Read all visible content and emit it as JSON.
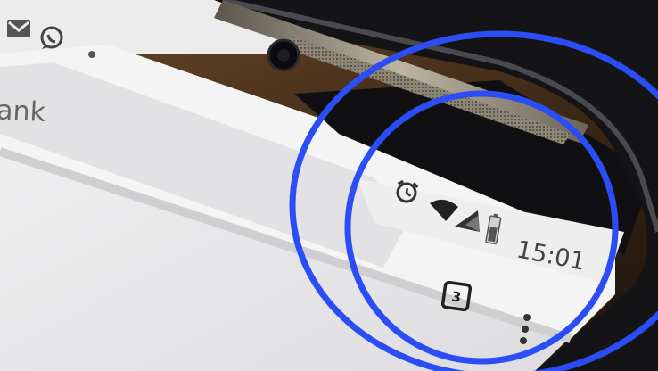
{
  "status_bar": {
    "time": "15:01",
    "notification_icons": [
      "gmail-icon",
      "whatsapp-icon",
      "notification-dot"
    ],
    "system_icons": [
      "alarm-icon",
      "wifi-icon",
      "signal-icon",
      "battery-icon"
    ]
  },
  "browser": {
    "address_text_fragment": "ank",
    "tab_count": "3",
    "menu_icon": "overflow-menu-icon"
  },
  "annotation": {
    "highlight_color": "#2b4df5",
    "shape": "double-circle-outline"
  }
}
